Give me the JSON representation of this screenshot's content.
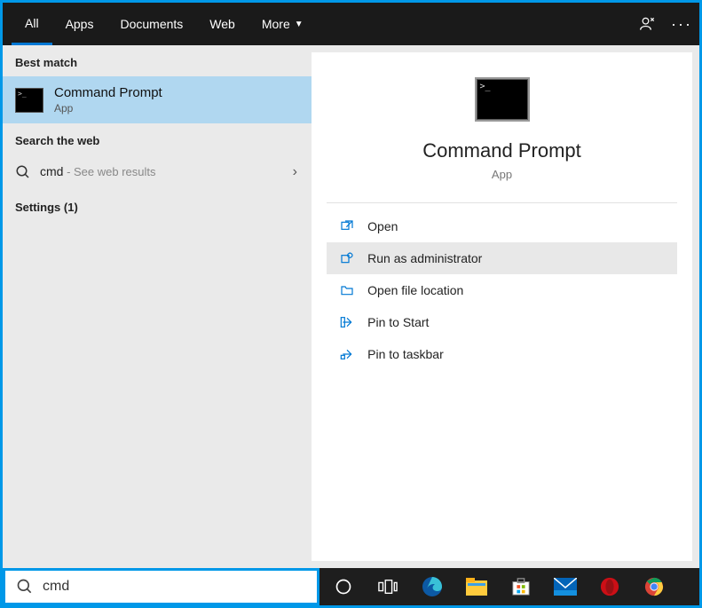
{
  "tabs": {
    "all": "All",
    "apps": "Apps",
    "documents": "Documents",
    "web": "Web",
    "more": "More"
  },
  "left": {
    "best_match_label": "Best match",
    "best_match_title": "Command Prompt",
    "best_match_sub": "App",
    "search_web_label": "Search the web",
    "web_query": "cmd",
    "web_sub": " - See web results",
    "settings_label": "Settings (1)"
  },
  "right": {
    "title": "Command Prompt",
    "subtitle": "App",
    "actions": {
      "open": "Open",
      "run_admin": "Run as administrator",
      "open_location": "Open file location",
      "pin_start": "Pin to Start",
      "pin_taskbar": "Pin to taskbar"
    }
  },
  "search": {
    "value": "cmd"
  }
}
